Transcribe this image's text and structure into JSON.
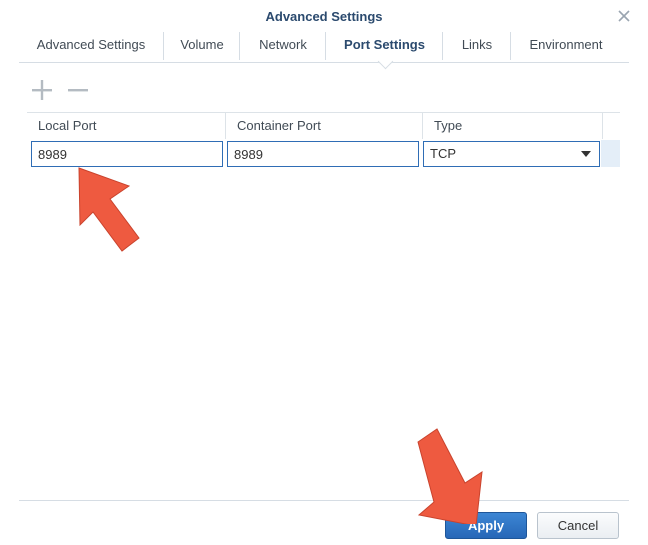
{
  "window": {
    "title": "Advanced Settings",
    "close_icon": "close-icon"
  },
  "tabs": [
    {
      "label": "Advanced Settings",
      "active": false
    },
    {
      "label": "Volume",
      "active": false
    },
    {
      "label": "Network",
      "active": false
    },
    {
      "label": "Port Settings",
      "active": true
    },
    {
      "label": "Links",
      "active": false
    },
    {
      "label": "Environment",
      "active": false
    }
  ],
  "toolbar": {
    "add_icon": "plus-icon",
    "remove_icon": "minus-icon"
  },
  "grid": {
    "columns": [
      "Local Port",
      "Container Port",
      "Type"
    ],
    "rows": [
      {
        "local_port": "8989",
        "container_port": "8989",
        "type": "TCP"
      }
    ]
  },
  "footer": {
    "apply_label": "Apply",
    "cancel_label": "Cancel"
  },
  "colors": {
    "title": "#2b4a6e",
    "accent": "#2f6db5",
    "apply_button": "#2767b7",
    "annotation_arrow": "#ee5a40"
  }
}
